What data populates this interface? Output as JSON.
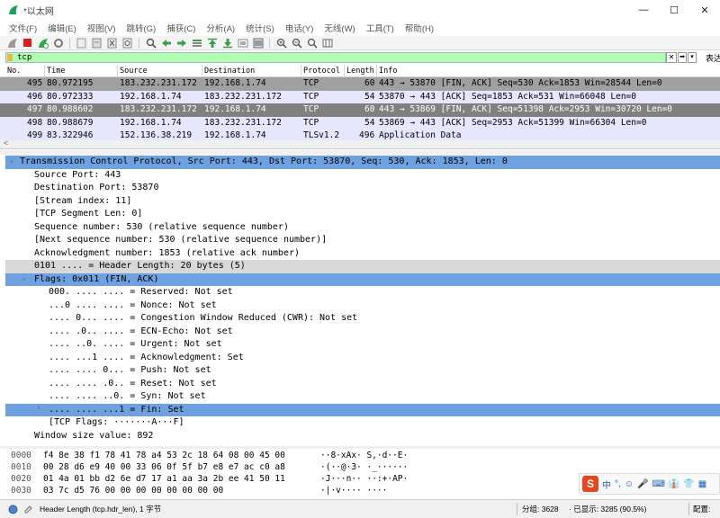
{
  "window": {
    "title": "*以太网",
    "logo_color": "#1aa15a"
  },
  "menu": [
    "文件(F)",
    "编辑(E)",
    "视图(V)",
    "跳转(G)",
    "捕获(C)",
    "分析(A)",
    "统计(S)",
    "电话(Y)",
    "无线(W)",
    "工具(T)",
    "帮助(H)"
  ],
  "toolbar": {
    "icons": [
      "shark-fin-start-icon",
      "stop-icon",
      "restart-icon",
      "options-gear-icon",
      "open-file-icon",
      "save-file-icon",
      "close-file-icon",
      "reload-icon",
      "find-icon",
      "go-back-icon",
      "go-forward-icon",
      "go-to-packet-icon",
      "go-first-icon",
      "go-last-icon",
      "autoscroll-icon",
      "colorize-icon",
      "zoom-in-icon",
      "zoom-out-icon",
      "zoom-normal-icon",
      "resize-columns-icon"
    ]
  },
  "filter": {
    "value": "tcp",
    "clear_label": "✕",
    "expression_label": "表达",
    "bg_color": "#afffaf"
  },
  "packet_list": {
    "columns": [
      "No.",
      "Time",
      "Source",
      "Destination",
      "Protocol",
      "Length",
      "Info"
    ],
    "rows": [
      {
        "no": "495",
        "time": "80.972195",
        "src": "183.232.231.172",
        "dst": "192.168.1.74",
        "proto": "TCP",
        "len": "60",
        "info": "443 → 53870 [FIN, ACK] Seq=530 Ack=1853 Win=28544 Len=0",
        "style": "fin"
      },
      {
        "no": "496",
        "time": "80.972333",
        "src": "192.168.1.74",
        "dst": "183.232.231.172",
        "proto": "TCP",
        "len": "54",
        "info": "53870 → 443 [ACK] Seq=1853 Ack=531 Win=66048 Len=0",
        "style": "tcp"
      },
      {
        "no": "497",
        "time": "80.988602",
        "src": "183.232.231.172",
        "dst": "192.168.1.74",
        "proto": "TCP",
        "len": "60",
        "info": "443 → 53869 [FIN, ACK] Seq=51398 Ack=2953 Win=30720 Len=0",
        "style": "fin-sel"
      },
      {
        "no": "498",
        "time": "80.988679",
        "src": "192.168.1.74",
        "dst": "183.232.231.172",
        "proto": "TCP",
        "len": "54",
        "info": "53869 → 443 [ACK] Seq=2953 Ack=51399 Win=66304 Len=0",
        "style": "tcp"
      },
      {
        "no": "499",
        "time": "83.322946",
        "src": "152.136.38.219",
        "dst": "192.168.1.74",
        "proto": "TLSv1.2",
        "len": "496",
        "info": "Application Data",
        "style": "tls"
      }
    ],
    "scroll_left": "<"
  },
  "details": [
    {
      "depth": 0,
      "twisty": "v",
      "text": "Transmission Control Protocol, Src Port: 443, Dst Port: 53870, Seq: 530, Ack: 1853, Len: 0",
      "style": "sel"
    },
    {
      "depth": 1,
      "twisty": "",
      "text": "Source Port: 443",
      "style": ""
    },
    {
      "depth": 1,
      "twisty": "",
      "text": "Destination Port: 53870",
      "style": ""
    },
    {
      "depth": 1,
      "twisty": "",
      "text": "[Stream index: 11]",
      "style": ""
    },
    {
      "depth": 1,
      "twisty": "",
      "text": "[TCP Segment Len: 0]",
      "style": ""
    },
    {
      "depth": 1,
      "twisty": "",
      "text": "Sequence number: 530    (relative sequence number)",
      "style": ""
    },
    {
      "depth": 1,
      "twisty": "",
      "text": "[Next sequence number: 530    (relative sequence number)]",
      "style": ""
    },
    {
      "depth": 1,
      "twisty": "",
      "text": "Acknowledgment number: 1853    (relative ack number)",
      "style": ""
    },
    {
      "depth": 1,
      "twisty": "",
      "text": "0101 .... = Header Length: 20 bytes (5)",
      "style": "hl"
    },
    {
      "depth": 1,
      "twisty": "v",
      "text": "Flags: 0x011 (FIN, ACK)",
      "style": "sel"
    },
    {
      "depth": 2,
      "twisty": "",
      "text": "000. .... .... = Reserved: Not set",
      "style": ""
    },
    {
      "depth": 2,
      "twisty": "",
      "text": "...0 .... .... = Nonce: Not set",
      "style": ""
    },
    {
      "depth": 2,
      "twisty": "",
      "text": ".... 0... .... = Congestion Window Reduced (CWR): Not set",
      "style": ""
    },
    {
      "depth": 2,
      "twisty": "",
      "text": ".... .0.. .... = ECN-Echo: Not set",
      "style": ""
    },
    {
      "depth": 2,
      "twisty": "",
      "text": ".... ..0. .... = Urgent: Not set",
      "style": ""
    },
    {
      "depth": 2,
      "twisty": "",
      "text": ".... ...1 .... = Acknowledgment: Set",
      "style": ""
    },
    {
      "depth": 2,
      "twisty": "",
      "text": ".... .... 0... = Push: Not set",
      "style": ""
    },
    {
      "depth": 2,
      "twisty": "",
      "text": ".... .... .0.. = Reset: Not set",
      "style": ""
    },
    {
      "depth": 2,
      "twisty": "",
      "text": ".... .... ..0. = Syn: Not set",
      "style": ""
    },
    {
      "depth": 2,
      "twisty": ">",
      "text": ".... .... ...1 = Fin: Set",
      "style": "selrow"
    },
    {
      "depth": 2,
      "twisty": "",
      "text": "[TCP Flags: ·······A···F]",
      "style": ""
    },
    {
      "depth": 1,
      "twisty": "",
      "text": "Window size value: 892",
      "style": ""
    }
  ],
  "hex": [
    {
      "offset": "0000",
      "bytes": "f4 8e 38 f1 78 41 78 a4  53 2c 18 64 08 00 45 00",
      "ascii": "··8·xAx· S,·d··E·"
    },
    {
      "offset": "0010",
      "bytes": "00 28 d6 e9 40 00 33 06  0f 5f b7 e8 e7 ac c0 a8",
      "ascii": "·(··@·3· ·_······"
    },
    {
      "offset": "0020",
      "bytes": "01 4a 01 bb d2 6e d7 17  a1 aa 3a 2b ee 41 50 11",
      "ascii": "·J···n·· ··:+·AP·"
    },
    {
      "offset": "0030",
      "bytes": "03 7c d5 76 00 00 00 00  00 00 00 00",
      "ascii": "·|·v···· ····"
    }
  ],
  "status": {
    "field_info": "Header Length (tcp.hdr_len), 1 字节",
    "packets": "分组: 3628",
    "displayed": "· 已显示: 3285 (90.5%)",
    "profile": "配置:"
  },
  "ime": {
    "logo": "S",
    "items": [
      "中",
      "°,",
      "☺",
      "🎤",
      "⌨",
      "👔",
      "👕",
      "▦"
    ]
  }
}
